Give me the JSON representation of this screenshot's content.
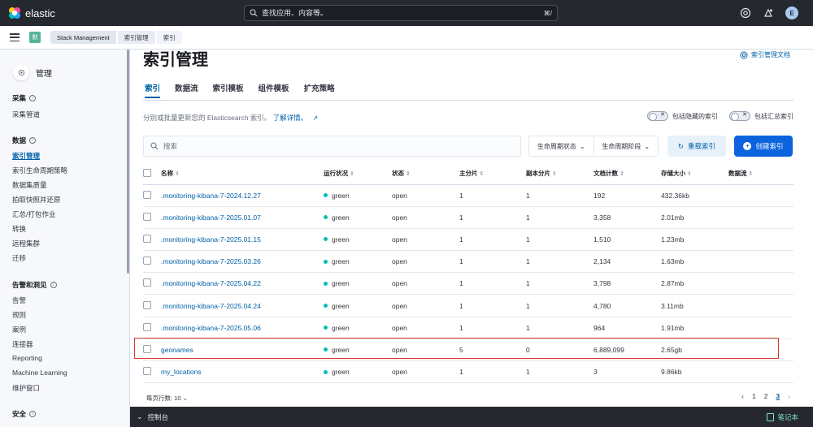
{
  "topbar": {
    "brand": "elastic",
    "search_placeholder": "查找应用、内容等。",
    "shortcut": "⌘/",
    "avatar": "E"
  },
  "breadcrumb": {
    "space": "默",
    "items": [
      "Stack Management",
      "索引管理",
      "索引"
    ]
  },
  "sidebar": {
    "title": "管理",
    "sections": [
      {
        "label": "采集",
        "items": [
          "采集管道"
        ]
      },
      {
        "label": "数据",
        "items": [
          "索引管理",
          "索引生命周期策略",
          "数据集质量",
          "拍取快照并还原",
          "汇总/打包作业",
          "转换",
          "远程集群",
          "迁移"
        ]
      },
      {
        "label": "告警和洞见",
        "items": [
          "告警",
          "规则",
          "案例",
          "连接器",
          "Reporting",
          "Machine Learning",
          "维护窗口"
        ]
      },
      {
        "label": "安全",
        "items": []
      }
    ],
    "active_item": "索引管理"
  },
  "main": {
    "title": "索引管理",
    "docs_link": "索引管理文档",
    "tabs": [
      "索引",
      "数据流",
      "索引模板",
      "组件模板",
      "扩充策略"
    ],
    "description": "分别或批量更新您的 Elasticsearch 索引。",
    "learn_more": "了解详情。",
    "toggle_hidden": "包括隐藏的索引",
    "toggle_rollup": "包括汇总索引",
    "search_placeholder": "搜索",
    "filter_status": "生命周期状态",
    "filter_phase": "生命周期阶段",
    "reload_button": "重载索引",
    "create_button": "创建索引"
  },
  "table": {
    "columns": [
      "名称",
      "运行状况",
      "状态",
      "主分片",
      "副本分片",
      "文档计数",
      "存储大小",
      "数据流"
    ],
    "rows": [
      {
        "name": ".monitoring-kibana-7-2024.12.27",
        "health": "green",
        "status": "open",
        "primary": "1",
        "replica": "1",
        "docs": "192",
        "size": "432.36kb",
        "stream": ""
      },
      {
        "name": ".monitoring-kibana-7-2025.01.07",
        "health": "green",
        "status": "open",
        "primary": "1",
        "replica": "1",
        "docs": "3,358",
        "size": "2.01mb",
        "stream": ""
      },
      {
        "name": ".monitoring-kibana-7-2025.01.15",
        "health": "green",
        "status": "open",
        "primary": "1",
        "replica": "1",
        "docs": "1,510",
        "size": "1.23mb",
        "stream": ""
      },
      {
        "name": ".monitoring-kibana-7-2025.03.26",
        "health": "green",
        "status": "open",
        "primary": "1",
        "replica": "1",
        "docs": "2,134",
        "size": "1.63mb",
        "stream": ""
      },
      {
        "name": ".monitoring-kibana-7-2025.04.22",
        "health": "green",
        "status": "open",
        "primary": "1",
        "replica": "1",
        "docs": "3,798",
        "size": "2.87mb",
        "stream": ""
      },
      {
        "name": ".monitoring-kibana-7-2025.04.24",
        "health": "green",
        "status": "open",
        "primary": "1",
        "replica": "1",
        "docs": "4,780",
        "size": "3.11mb",
        "stream": ""
      },
      {
        "name": ".monitoring-kibana-7-2025.05.06",
        "health": "green",
        "status": "open",
        "primary": "1",
        "replica": "1",
        "docs": "964",
        "size": "1.91mb",
        "stream": ""
      },
      {
        "name": "geonames",
        "health": "green",
        "status": "open",
        "primary": "5",
        "replica": "0",
        "docs": "6,889,099",
        "size": "2.65gb",
        "stream": ""
      },
      {
        "name": "my_locations",
        "health": "green",
        "status": "open",
        "primary": "1",
        "replica": "1",
        "docs": "3",
        "size": "9.86kb",
        "stream": ""
      }
    ],
    "rows_per_page": "每页行数: 10",
    "pages": [
      "1",
      "2",
      "3"
    ],
    "current_page": "3"
  },
  "console": {
    "label": "控制台",
    "notebook": "笔记本"
  },
  "colors": {
    "topbar": "#25282f",
    "accent": "#0061a6",
    "primary_button": "#0b64dd",
    "health_green": "#00bfb3",
    "highlight": "#d9342b"
  }
}
